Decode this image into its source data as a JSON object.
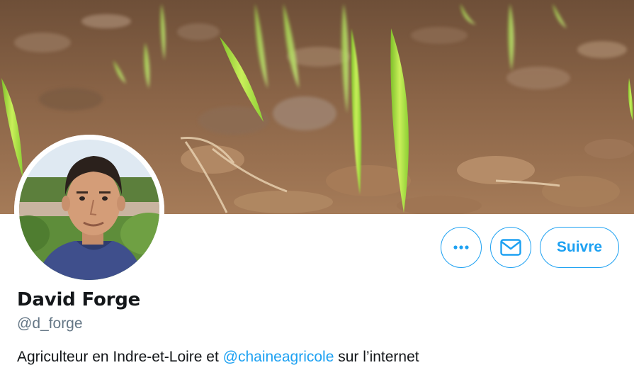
{
  "profile": {
    "display_name": "David Forge",
    "handle": "@d_forge",
    "bio": {
      "text_before": "Agriculteur en Indre-et-Loire et ",
      "mention": "@chaineagricole",
      "text_after": " sur l’internet"
    }
  },
  "actions": {
    "more_icon": "more-horizontal-icon",
    "message_icon": "envelope-icon",
    "follow_label": "Suivre"
  },
  "colors": {
    "accent": "#1da1f2",
    "name_text": "#14171a",
    "secondary_text": "#657786"
  }
}
